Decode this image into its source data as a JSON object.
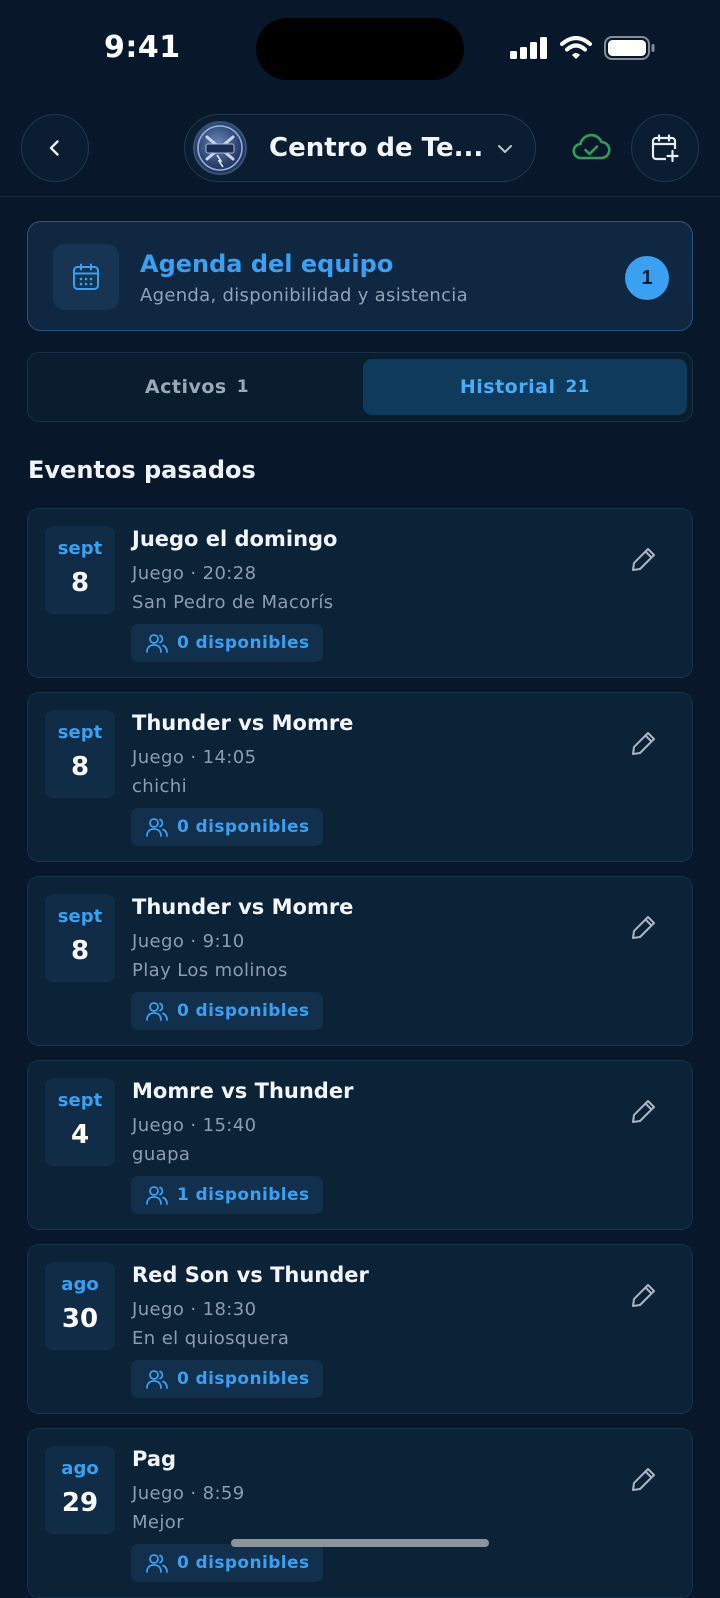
{
  "status_bar": {
    "time": "9:41"
  },
  "header": {
    "back_icon": "chevron-left-icon",
    "team_name": "Centro de Te...",
    "dropdown_icon": "chevron-down-icon",
    "sync_icon": "cloud-check-icon",
    "add_event_icon": "calendar-plus-icon",
    "sync_color": "#2e9e5a"
  },
  "agenda": {
    "title": "Agenda del equipo",
    "subtitle": "Agenda, disponibilidad y asistencia",
    "count": "1",
    "icon": "calendar-icon"
  },
  "tabs": [
    {
      "label": "Activos",
      "count": "1"
    },
    {
      "label": "Historial",
      "count": "21"
    }
  ],
  "section_title": "Eventos pasados",
  "events": [
    {
      "month": "sept",
      "day": "8",
      "title": "Juego el domingo",
      "meta": "Juego · 20:28",
      "place": "San Pedro de Macorís",
      "available": "0 disponibles"
    },
    {
      "month": "sept",
      "day": "8",
      "title": "Thunder vs Momre",
      "meta": "Juego · 14:05",
      "place": "chichi",
      "available": "0 disponibles"
    },
    {
      "month": "sept",
      "day": "8",
      "title": "Thunder vs Momre",
      "meta": "Juego · 9:10",
      "place": "Play Los molinos",
      "available": "0 disponibles"
    },
    {
      "month": "sept",
      "day": "4",
      "title": "Momre vs Thunder",
      "meta": "Juego · 15:40",
      "place": "guapa",
      "available": "1 disponibles"
    },
    {
      "month": "ago",
      "day": "30",
      "title": "Red Son vs Thunder",
      "meta": "Juego · 18:30",
      "place": "En el quiosquera",
      "available": "0 disponibles"
    },
    {
      "month": "ago",
      "day": "29",
      "title": "Pag",
      "meta": "Juego · 8:59",
      "place": "Mejor",
      "available": "0 disponibles"
    }
  ],
  "colors": {
    "accent": "#3aa0f2",
    "background": "#08182a",
    "card": "#0c2237"
  }
}
